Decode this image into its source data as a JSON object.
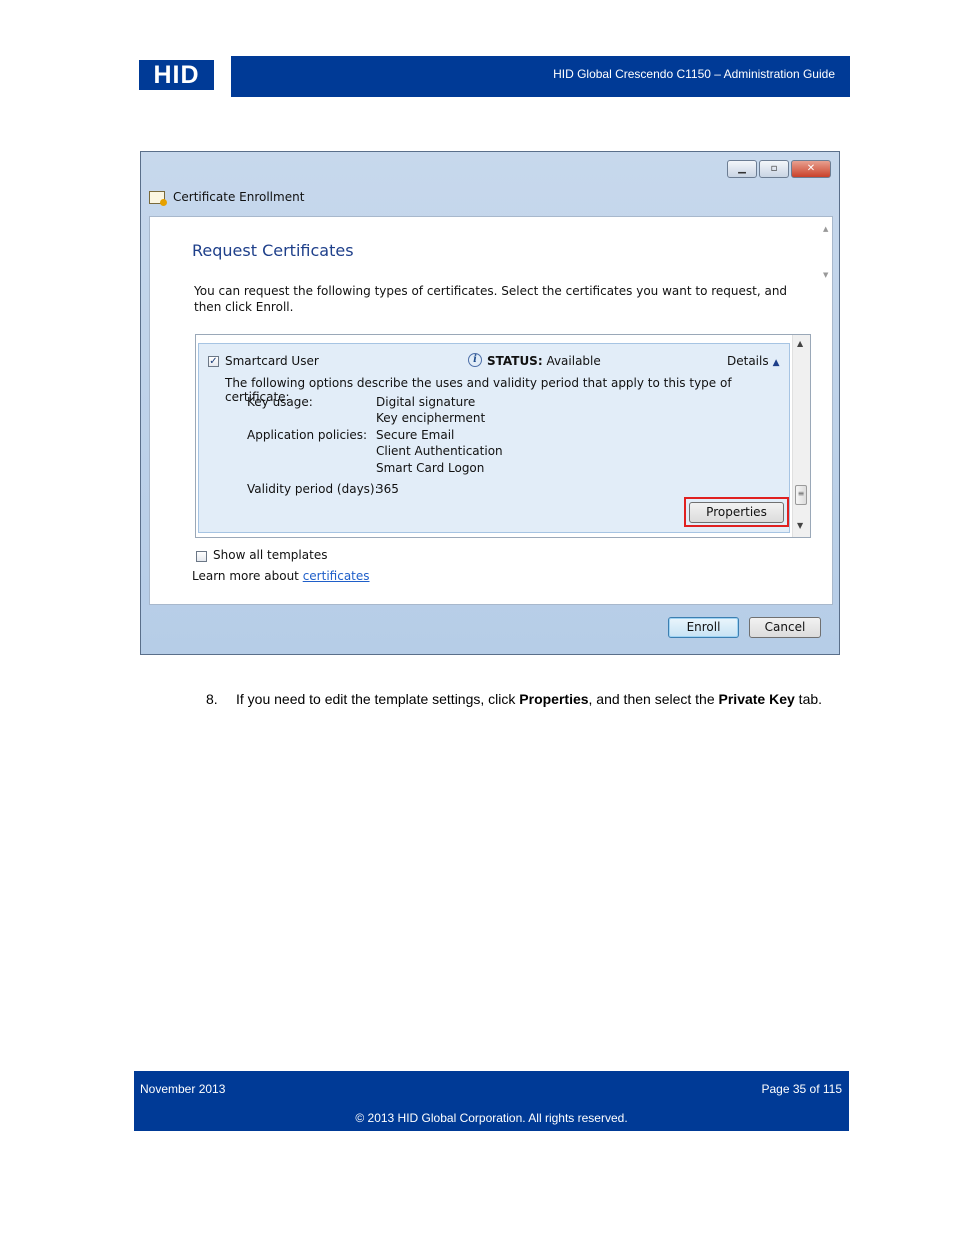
{
  "header": {
    "logo_text": "HID",
    "doc_title": "HID Global Crescendo C1150  – Administration Guide"
  },
  "dialog": {
    "window_title": "Certificate Enrollment",
    "heading": "Request Certificates",
    "intro": "You can request the following types of certificates. Select the certificates you want to request, and then click Enroll.",
    "item": {
      "checked": true,
      "name": "Smartcard User",
      "status_label": "STATUS:",
      "status_value": "Available",
      "details_label": "Details",
      "description": "The following options describe the uses and validity period that apply to this type of certificate:",
      "key_usage_label": "Key usage:",
      "key_usage_values": [
        "Digital signature",
        "Key encipherment"
      ],
      "app_policies_label": "Application policies:",
      "app_policies_values": [
        "Secure Email",
        "Client Authentication",
        "Smart Card Logon"
      ],
      "validity_label": "Validity period (days):",
      "validity_value": "365",
      "properties_button": "Properties"
    },
    "show_all_templates": "Show all templates",
    "learn_more_prefix": "Learn more about ",
    "learn_more_link": "certificates",
    "enroll_button": "Enroll",
    "cancel_button": "Cancel"
  },
  "step": {
    "number": "8.",
    "text_1": "If you need to edit the template settings, click ",
    "bold_1": "Properties",
    "text_2": ", and then select the ",
    "bold_2": "Private Key",
    "text_3": " tab."
  },
  "footer": {
    "date": "November 2013",
    "page": "Page 35 of 115",
    "copyright": "© 2013 HID Global Corporation. All rights reserved."
  },
  "colors": {
    "brand_blue": "#003a96",
    "highlight_red": "#e02020",
    "link_blue": "#1f5fc9"
  }
}
